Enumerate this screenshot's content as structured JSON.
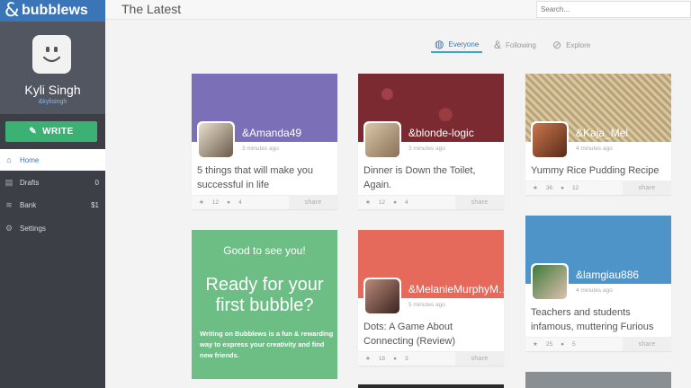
{
  "app": {
    "logo_amp": "&",
    "logo_word": "bubblews"
  },
  "topbar": {
    "title": "The Latest",
    "search_placeholder": "Search..."
  },
  "profile": {
    "name": "Kyli Singh",
    "handle": "&kylisingh"
  },
  "write_button": "WRITE",
  "nav": [
    {
      "label": "Home",
      "icon": "home-icon",
      "count": ""
    },
    {
      "label": "Drafts",
      "icon": "drafts-icon",
      "count": "0"
    },
    {
      "label": "Bank",
      "icon": "bank-icon",
      "count": "$1"
    },
    {
      "label": "Settings",
      "icon": "gear-icon",
      "count": ""
    }
  ],
  "filters": [
    {
      "label": "Everyone",
      "icon": "globe-icon",
      "active": true
    },
    {
      "label": "Following",
      "icon": "ampersand-icon",
      "active": false
    },
    {
      "label": "Explore",
      "icon": "compass-icon",
      "active": false
    }
  ],
  "cards": [
    {
      "user": "&Amanda49",
      "time": "3 minutes ago",
      "title": "5 things that will make you successful in life",
      "likes": "12",
      "comments": "4",
      "share": "share",
      "header_color": "#7b6fb8"
    },
    {
      "user": "&blonde-logic",
      "time": "3 minutes ago",
      "title": "Dinner is Down the Toilet, Again.",
      "likes": "12",
      "comments": "4",
      "share": "share",
      "header_color": "#7a2a30"
    },
    {
      "user": "&Kaja_Mel",
      "time": "4 minutes ago",
      "title": "Yummy Rice Pudding Recipe",
      "likes": "36",
      "comments": "12",
      "share": "share",
      "header_color": "#c9b48a"
    },
    {
      "user": "&MelanieMurphyM…",
      "time": "5 minutes ago",
      "title": "Dots: A Game About Connecting (Review)",
      "likes": "18",
      "comments": "3",
      "share": "share",
      "header_color": "#e56a5c"
    },
    {
      "user": "&lamgiau886",
      "time": "4 minutes ago",
      "title": "Teachers and students infamous, muttering Furious",
      "likes": "25",
      "comments": "5",
      "share": "share",
      "header_color": "#4f94c9"
    }
  ],
  "greeting": {
    "line1": "Good to see you!",
    "line2": "Ready for your first bubble?",
    "line3": "Writing on Bubblews is a fun & rewarding way to express your creativity and find new friends."
  },
  "colors": {
    "brand": "#3a75b8",
    "sidebar": "#3c3f46",
    "write": "#3bb274",
    "greeting": "#6cbe85"
  }
}
